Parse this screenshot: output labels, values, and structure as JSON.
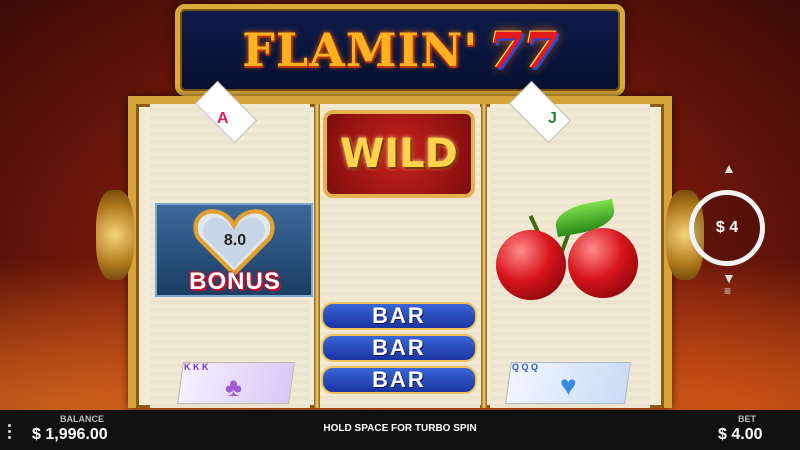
{
  "title": {
    "text": "FLAMIN'",
    "sevens": "77"
  },
  "reels": {
    "reel1": {
      "top_card_letter": "A",
      "bonus_value": "8.0",
      "bonus_label": "BONUS",
      "bottom_card_letters": "K K K"
    },
    "reel2": {
      "wild_label": "WILD",
      "bars": [
        "BAR",
        "BAR",
        "BAR"
      ]
    },
    "reel3": {
      "top_card_letter": "J",
      "bottom_card_letters": "Q Q Q"
    }
  },
  "bet_badge": {
    "label": "$ 4"
  },
  "bottom_bar": {
    "balance_label": "BALANCE",
    "balance_value": "$ 1,996.00",
    "hint": "HOLD SPACE FOR TURBO SPIN",
    "bet_label": "BET",
    "bet_value": "$ 4.00"
  },
  "colors": {
    "frame_gold": "#d7a43a",
    "banner_navy": "#0e1b4a",
    "bar_blue": "#1a34a0",
    "wild_red": "#c8221c"
  },
  "icons": [
    "menu-dots-icon",
    "spin-arrows-icon",
    "chevron-up-icon",
    "chevron-down-icon",
    "heart-gem-icon",
    "cherry-icon"
  ]
}
